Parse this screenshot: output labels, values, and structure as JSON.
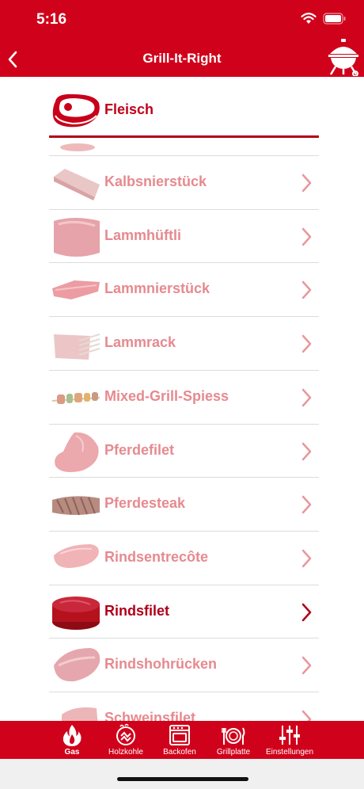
{
  "status": {
    "time": "5:16"
  },
  "nav": {
    "title": "Grill-It-Right",
    "back_icon": "chevron-left-icon",
    "action_icon": "kettle-grill-icon"
  },
  "section": {
    "title": "Fleisch",
    "icon": "steak-icon"
  },
  "items": [
    {
      "label": "Kalbsnierstück"
    },
    {
      "label": "Lammhüftli"
    },
    {
      "label": "Lammnierstück"
    },
    {
      "label": "Lammrack"
    },
    {
      "label": "Mixed-Grill-Spiess"
    },
    {
      "label": "Pferdefilet"
    },
    {
      "label": "Pferdesteak"
    },
    {
      "label": "Rindsentrecôte"
    },
    {
      "label": "Rindsfilet",
      "active": true
    },
    {
      "label": "Rindshohrücken"
    },
    {
      "label": "Schweinsfilet"
    }
  ],
  "tabs": [
    {
      "label": "Gas",
      "icon": "flame-icon",
      "active": true
    },
    {
      "label": "Holzkohle",
      "icon": "charcoal-icon"
    },
    {
      "label": "Backofen",
      "icon": "oven-icon"
    },
    {
      "label": "Grillplatte",
      "icon": "plate-cutlery-icon"
    },
    {
      "label": "Einstellungen",
      "icon": "sliders-icon"
    }
  ],
  "colors": {
    "brand": "#d0021b",
    "active_text": "#b0001a",
    "inactive_text": "#e68a8f"
  }
}
